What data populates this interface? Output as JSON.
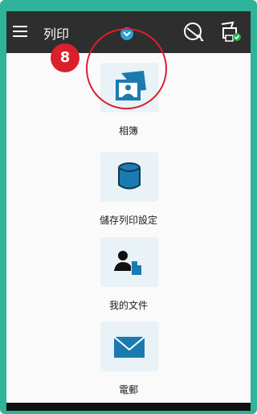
{
  "header": {
    "title": "列印",
    "menu_icon": "menu-icon",
    "dropdown_icon": "chevron-down-icon",
    "status_icon": "printer-status-icon",
    "printer_icon": "printer-connected-icon"
  },
  "annotation": {
    "step": "8"
  },
  "items": [
    {
      "label": "相簿",
      "icon": "photo-album-icon"
    },
    {
      "label": "儲存列印設定",
      "icon": "storage-icon"
    },
    {
      "label": "我的文件",
      "icon": "document-icon"
    },
    {
      "label": "電郵",
      "icon": "mail-icon"
    }
  ],
  "colors": {
    "topbar": "#2e2e2e",
    "accent": "#2aa0d8",
    "icon_blue": "#1b7bb0",
    "tile_bg": "#e9f2f7",
    "highlight": "#d9202b",
    "frame": "#2fb39a"
  }
}
